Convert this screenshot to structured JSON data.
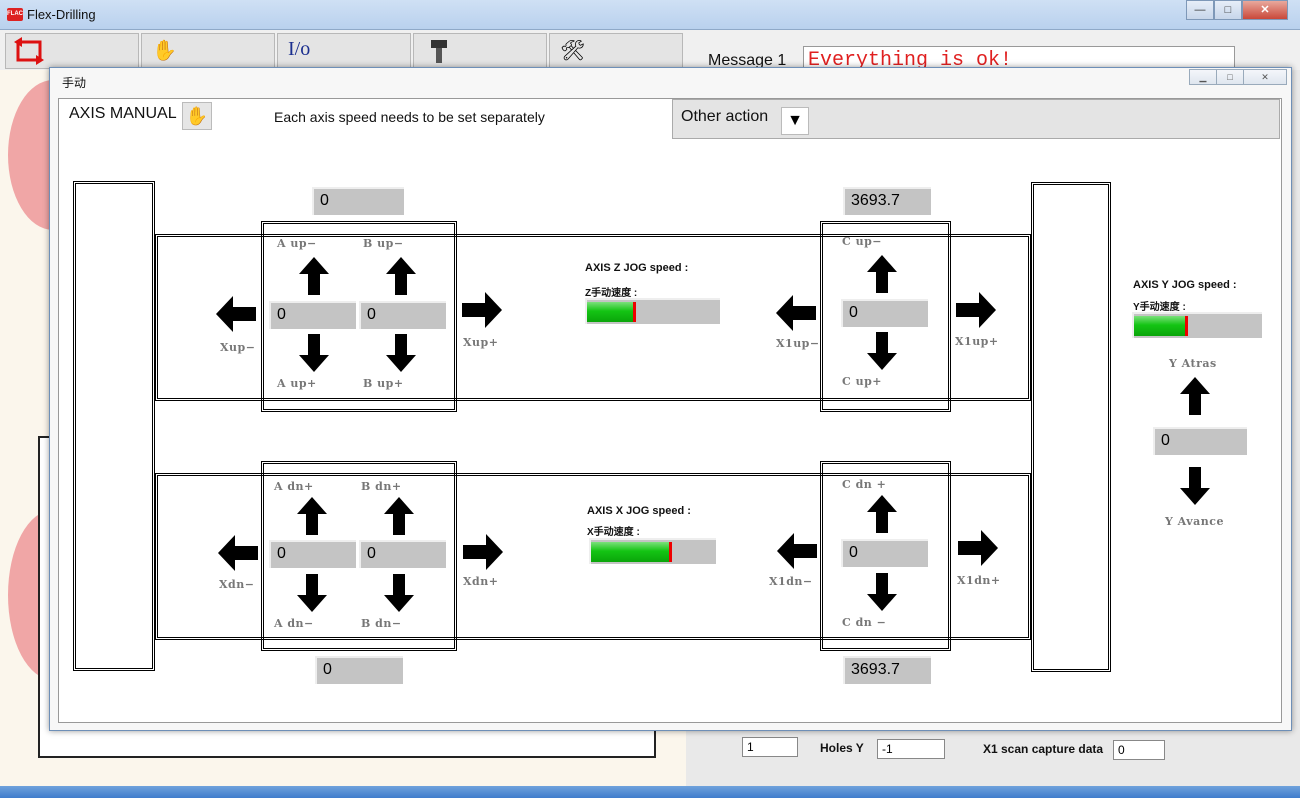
{
  "window": {
    "title": "Flex-Drilling",
    "app_badge": "FLAC",
    "minimize": "—",
    "maximize": "□",
    "close": "✕"
  },
  "toolbar": {
    "icons": [
      "refresh-icon",
      "hand-icon",
      "io-icon",
      "drill-icon",
      "tools-icon"
    ],
    "io_text": "I/o"
  },
  "message": {
    "label": "Message 1",
    "text": "Everything is ok!"
  },
  "bottom": {
    "field1": "1",
    "holes_y_label": "Holes Y",
    "holes_y_value": "-1",
    "x1_scan_label": "X1 scan capture data",
    "x1_scan_value": "0"
  },
  "dialog": {
    "title": "手动",
    "tab_axis": "AXIS MANUAL",
    "description": "Each axis speed needs to be set separately",
    "tab_other": "Other action"
  },
  "top_row": {
    "ab_readout": "0",
    "c_readout": "3693.7",
    "a_value": "0",
    "b_value": "0",
    "c_value": "0",
    "a_up_minus": "A up−",
    "b_up_minus": "B up−",
    "a_up_plus": "A up+",
    "b_up_plus": "B up+",
    "c_up_minus": "C up−",
    "c_up_plus": "C up+",
    "xup_minus": "Xup−",
    "xup_plus": "Xup+",
    "x1up_minus": "X1up−",
    "x1up_plus": "X1up+",
    "speed_title": "AXIS Z JOG speed :",
    "speed_sub": "Z手动速度 :",
    "speed_fraction": 0.37
  },
  "bottom_row": {
    "ab_readout": "0",
    "c_readout": "3693.7",
    "a_value": "0",
    "b_value": "0",
    "c_value": "0",
    "a_dn_plus": "A dn+",
    "b_dn_plus": "B dn+",
    "a_dn_minus": "A dn−",
    "b_dn_minus": "B dn−",
    "c_dn_plus": "C dn +",
    "c_dn_minus": "C dn −",
    "xdn_minus": "Xdn−",
    "xdn_plus": "Xdn+",
    "x1dn_minus": "X1dn−",
    "x1dn_plus": "X1dn+",
    "speed_title": "AXIS X JOG speed :",
    "speed_sub": "X手动速度 :",
    "speed_fraction": 0.65
  },
  "y_axis": {
    "speed_title": "AXIS Y JOG speed :",
    "speed_sub": "Y手动速度 :",
    "speed_fraction": 0.42,
    "atras": "Y Atras",
    "avance": "Y Avance",
    "value": "0"
  },
  "colors": {
    "speed_green": "#14c414",
    "speed_marker": "#e00000",
    "message_red": "#e02020",
    "field_gray": "#c4c4c4"
  }
}
